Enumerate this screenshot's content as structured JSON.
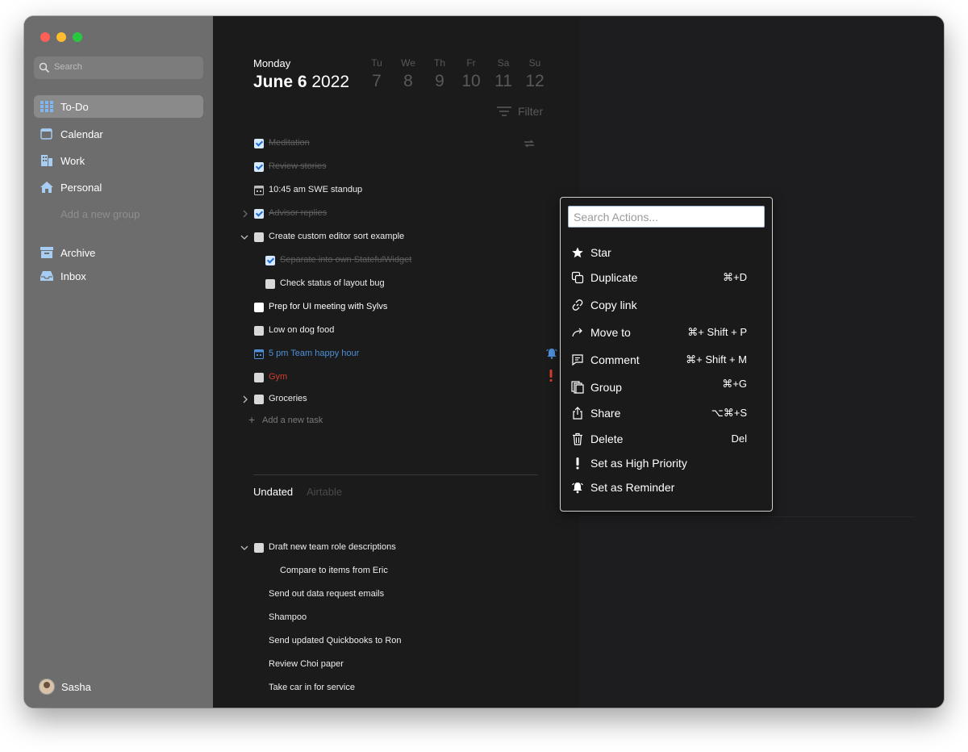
{
  "sidebar": {
    "search_placeholder": "Search",
    "items": [
      {
        "label": "To-Do",
        "icon": "grid-icon"
      },
      {
        "label": "Calendar",
        "icon": "calendar-icon"
      },
      {
        "label": "Work",
        "icon": "building-icon"
      },
      {
        "label": "Personal",
        "icon": "home-icon"
      }
    ],
    "add_group_label": "Add a new group",
    "archive_label": "Archive",
    "inbox_label": "Inbox",
    "user_name": "Sasha"
  },
  "header": {
    "day_name": "Monday",
    "date_bold": "June 6",
    "year": "2022",
    "week": [
      {
        "day": "Tu",
        "num": "7"
      },
      {
        "day": "We",
        "num": "8"
      },
      {
        "day": "Th",
        "num": "9"
      },
      {
        "day": "Fr",
        "num": "10"
      },
      {
        "day": "Sa",
        "num": "11"
      },
      {
        "day": "Su",
        "num": "12"
      }
    ],
    "filter_label": "Filter"
  },
  "tasks": [
    {
      "label": "Meditation",
      "state": "done"
    },
    {
      "label": "Review stories",
      "state": "done"
    },
    {
      "label": "10:45 am SWE standup",
      "state": "event"
    },
    {
      "label": "Advisor replies",
      "state": "done"
    },
    {
      "label": "Create custom editor sort example",
      "state": "open"
    },
    {
      "label": "Separate into own StatefulWidget",
      "state": "done"
    },
    {
      "label": "Check status of layout bug",
      "state": "open"
    },
    {
      "label": "Prep for UI meeting with Sylvs",
      "state": "open"
    },
    {
      "label": "Low on dog food",
      "state": "open"
    },
    {
      "label": "5 pm Team happy hour",
      "state": "event"
    },
    {
      "label": "Gym",
      "state": "open"
    },
    {
      "label": "Groceries",
      "state": "open"
    }
  ],
  "add_task_label": "Add a new task",
  "sections": {
    "undated": "Undated",
    "airtable": "Airtable"
  },
  "undated_tasks": [
    {
      "label": "Draft new team role descriptions"
    },
    {
      "label": "Compare to items from Eric"
    },
    {
      "label": "Send out data request emails"
    },
    {
      "label": "Shampoo"
    },
    {
      "label": "Send updated Quickbooks to Ron"
    },
    {
      "label": "Review Choi paper"
    },
    {
      "label": "Take car in for service"
    }
  ],
  "action_menu": {
    "search_placeholder": "Search Actions...",
    "items": [
      {
        "label": "Star",
        "shortcut": "",
        "icon": "star-icon"
      },
      {
        "label": "Duplicate",
        "shortcut": "⌘+D",
        "icon": "duplicate-icon"
      },
      {
        "label": "Copy link",
        "shortcut": "",
        "icon": "link-icon"
      },
      {
        "label": "Move to",
        "shortcut": "⌘+ Shift + P",
        "icon": "arrow-right-icon"
      },
      {
        "label": "Comment",
        "shortcut": "⌘+ Shift + M",
        "icon": "comment-icon"
      },
      {
        "label": "Group",
        "shortcut": "⌘+G",
        "icon": "group-icon"
      },
      {
        "label": "Share",
        "shortcut": "⌥⌘+S",
        "icon": "share-icon"
      },
      {
        "label": "Delete",
        "shortcut": "Del",
        "icon": "trash-icon"
      },
      {
        "label": "Set as High Priority",
        "shortcut": "",
        "icon": "exclamation-icon"
      },
      {
        "label": "Set as Reminder",
        "shortcut": "",
        "icon": "bell-icon"
      }
    ]
  },
  "colors": {
    "sidebar_bg": "#6d6d6d",
    "main_bg": "#1b1b1b",
    "accent_blue": "#4d8fd8",
    "priority_red": "#d23d30"
  }
}
